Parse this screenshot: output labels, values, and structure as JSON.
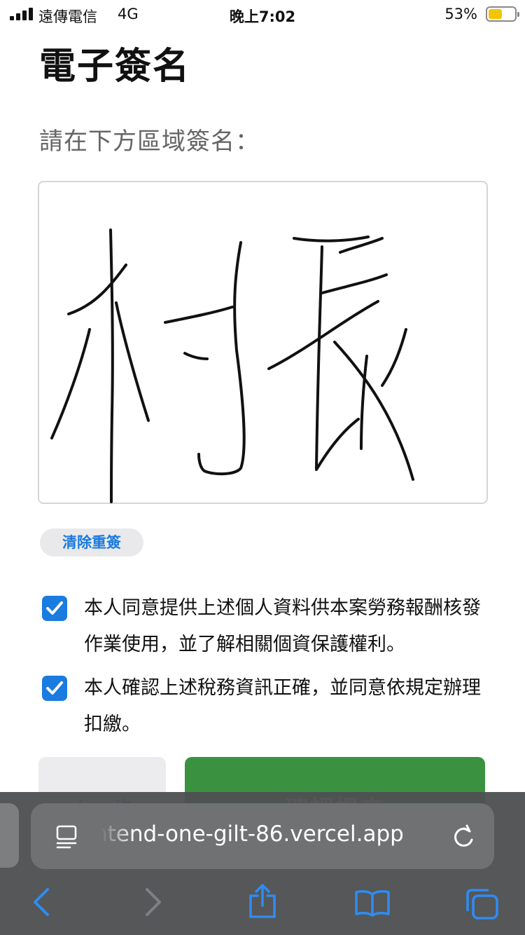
{
  "status_bar": {
    "carrier": "遠傳電信",
    "network": "4G",
    "time": "晚上7:02",
    "battery_percent": "53%",
    "battery_level": 0.53,
    "battery_color": "#f5c400"
  },
  "page": {
    "title": "電子簽名",
    "instruction": "請在下方區域簽名："
  },
  "signature_pad": {
    "has_signature": true
  },
  "clear_button": {
    "label": "清除重簽"
  },
  "consents": [
    {
      "checked": true,
      "text": "本人同意提供上述個人資料供本案勞務報酬核發作業使用，並了解相關個資保護權利。"
    },
    {
      "checked": true,
      "text": "本人確認上述稅務資訊正確，並同意依規定辦理扣繳。"
    }
  ],
  "actions": {
    "previous_label": "上一步",
    "submit_label": "確認提交"
  },
  "browser": {
    "url": "ntend-one-gilt-86.vercel.app",
    "icons": [
      "reader-icon",
      "reload-icon",
      "back-icon",
      "forward-icon",
      "share-icon",
      "bookmarks-icon",
      "tabs-icon"
    ]
  },
  "colors": {
    "accent_blue": "#1a7be0",
    "submit_green": "#3a9240",
    "toolbar_bg": "#4e5052"
  }
}
